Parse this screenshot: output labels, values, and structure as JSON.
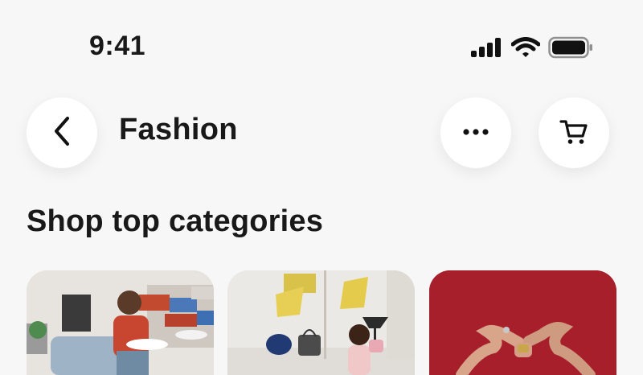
{
  "status_bar": {
    "time": "9:41",
    "icons": [
      "cellular-signal-icon",
      "wifi-icon",
      "battery-icon"
    ]
  },
  "header": {
    "title": "Fashion",
    "back_icon": "chevron-left-icon",
    "more_icon": "more-horizontal-icon",
    "cart_icon": "cart-icon"
  },
  "section": {
    "title": "Shop top categories"
  },
  "categories": [
    {
      "image": "sneakers-photo"
    },
    {
      "image": "handbags-photo"
    },
    {
      "image": "jewelry-photo"
    }
  ],
  "colors": {
    "background": "#f7f7f7",
    "text": "#191919",
    "button_bg": "#ffffff",
    "card3_bg": "#a81f2c"
  }
}
